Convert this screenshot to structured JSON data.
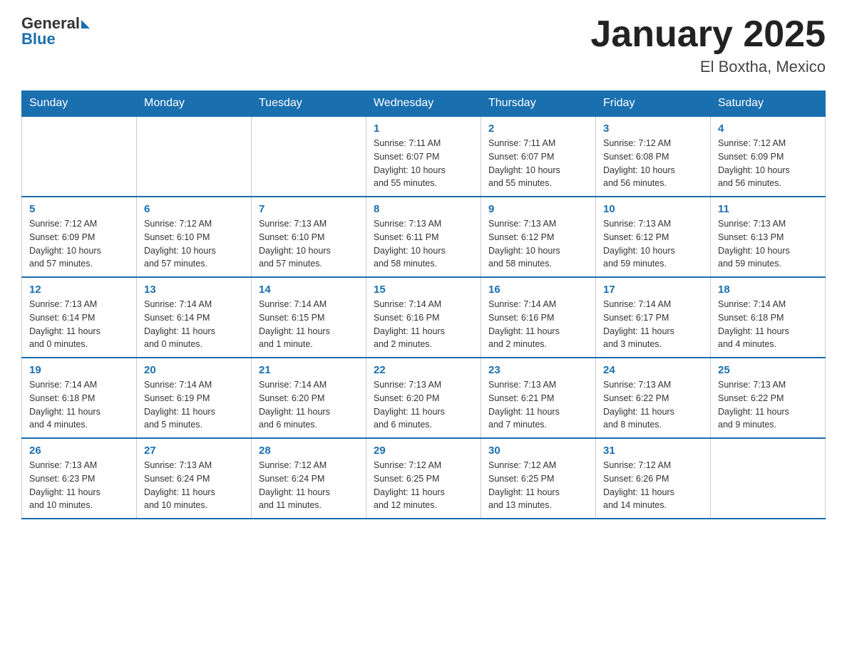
{
  "header": {
    "logo_text_general": "General",
    "logo_text_blue": "Blue",
    "title": "January 2025",
    "subtitle": "El Boxtha, Mexico"
  },
  "weekdays": [
    "Sunday",
    "Monday",
    "Tuesday",
    "Wednesday",
    "Thursday",
    "Friday",
    "Saturday"
  ],
  "weeks": [
    [
      {
        "day": "",
        "info": ""
      },
      {
        "day": "",
        "info": ""
      },
      {
        "day": "",
        "info": ""
      },
      {
        "day": "1",
        "info": "Sunrise: 7:11 AM\nSunset: 6:07 PM\nDaylight: 10 hours\nand 55 minutes."
      },
      {
        "day": "2",
        "info": "Sunrise: 7:11 AM\nSunset: 6:07 PM\nDaylight: 10 hours\nand 55 minutes."
      },
      {
        "day": "3",
        "info": "Sunrise: 7:12 AM\nSunset: 6:08 PM\nDaylight: 10 hours\nand 56 minutes."
      },
      {
        "day": "4",
        "info": "Sunrise: 7:12 AM\nSunset: 6:09 PM\nDaylight: 10 hours\nand 56 minutes."
      }
    ],
    [
      {
        "day": "5",
        "info": "Sunrise: 7:12 AM\nSunset: 6:09 PM\nDaylight: 10 hours\nand 57 minutes."
      },
      {
        "day": "6",
        "info": "Sunrise: 7:12 AM\nSunset: 6:10 PM\nDaylight: 10 hours\nand 57 minutes."
      },
      {
        "day": "7",
        "info": "Sunrise: 7:13 AM\nSunset: 6:10 PM\nDaylight: 10 hours\nand 57 minutes."
      },
      {
        "day": "8",
        "info": "Sunrise: 7:13 AM\nSunset: 6:11 PM\nDaylight: 10 hours\nand 58 minutes."
      },
      {
        "day": "9",
        "info": "Sunrise: 7:13 AM\nSunset: 6:12 PM\nDaylight: 10 hours\nand 58 minutes."
      },
      {
        "day": "10",
        "info": "Sunrise: 7:13 AM\nSunset: 6:12 PM\nDaylight: 10 hours\nand 59 minutes."
      },
      {
        "day": "11",
        "info": "Sunrise: 7:13 AM\nSunset: 6:13 PM\nDaylight: 10 hours\nand 59 minutes."
      }
    ],
    [
      {
        "day": "12",
        "info": "Sunrise: 7:13 AM\nSunset: 6:14 PM\nDaylight: 11 hours\nand 0 minutes."
      },
      {
        "day": "13",
        "info": "Sunrise: 7:14 AM\nSunset: 6:14 PM\nDaylight: 11 hours\nand 0 minutes."
      },
      {
        "day": "14",
        "info": "Sunrise: 7:14 AM\nSunset: 6:15 PM\nDaylight: 11 hours\nand 1 minute."
      },
      {
        "day": "15",
        "info": "Sunrise: 7:14 AM\nSunset: 6:16 PM\nDaylight: 11 hours\nand 2 minutes."
      },
      {
        "day": "16",
        "info": "Sunrise: 7:14 AM\nSunset: 6:16 PM\nDaylight: 11 hours\nand 2 minutes."
      },
      {
        "day": "17",
        "info": "Sunrise: 7:14 AM\nSunset: 6:17 PM\nDaylight: 11 hours\nand 3 minutes."
      },
      {
        "day": "18",
        "info": "Sunrise: 7:14 AM\nSunset: 6:18 PM\nDaylight: 11 hours\nand 4 minutes."
      }
    ],
    [
      {
        "day": "19",
        "info": "Sunrise: 7:14 AM\nSunset: 6:18 PM\nDaylight: 11 hours\nand 4 minutes."
      },
      {
        "day": "20",
        "info": "Sunrise: 7:14 AM\nSunset: 6:19 PM\nDaylight: 11 hours\nand 5 minutes."
      },
      {
        "day": "21",
        "info": "Sunrise: 7:14 AM\nSunset: 6:20 PM\nDaylight: 11 hours\nand 6 minutes."
      },
      {
        "day": "22",
        "info": "Sunrise: 7:13 AM\nSunset: 6:20 PM\nDaylight: 11 hours\nand 6 minutes."
      },
      {
        "day": "23",
        "info": "Sunrise: 7:13 AM\nSunset: 6:21 PM\nDaylight: 11 hours\nand 7 minutes."
      },
      {
        "day": "24",
        "info": "Sunrise: 7:13 AM\nSunset: 6:22 PM\nDaylight: 11 hours\nand 8 minutes."
      },
      {
        "day": "25",
        "info": "Sunrise: 7:13 AM\nSunset: 6:22 PM\nDaylight: 11 hours\nand 9 minutes."
      }
    ],
    [
      {
        "day": "26",
        "info": "Sunrise: 7:13 AM\nSunset: 6:23 PM\nDaylight: 11 hours\nand 10 minutes."
      },
      {
        "day": "27",
        "info": "Sunrise: 7:13 AM\nSunset: 6:24 PM\nDaylight: 11 hours\nand 10 minutes."
      },
      {
        "day": "28",
        "info": "Sunrise: 7:12 AM\nSunset: 6:24 PM\nDaylight: 11 hours\nand 11 minutes."
      },
      {
        "day": "29",
        "info": "Sunrise: 7:12 AM\nSunset: 6:25 PM\nDaylight: 11 hours\nand 12 minutes."
      },
      {
        "day": "30",
        "info": "Sunrise: 7:12 AM\nSunset: 6:25 PM\nDaylight: 11 hours\nand 13 minutes."
      },
      {
        "day": "31",
        "info": "Sunrise: 7:12 AM\nSunset: 6:26 PM\nDaylight: 11 hours\nand 14 minutes."
      },
      {
        "day": "",
        "info": ""
      }
    ]
  ]
}
